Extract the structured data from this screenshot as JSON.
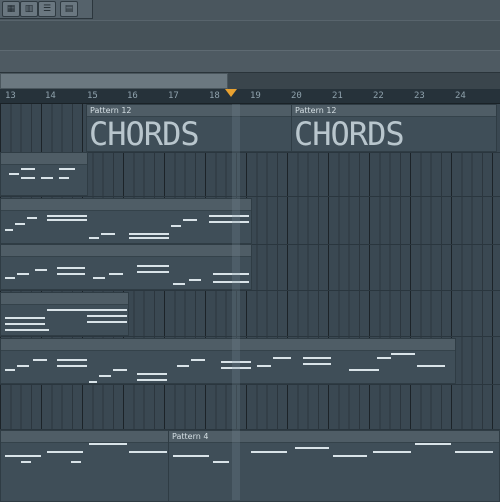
{
  "toolbar": {
    "buttons": [
      {
        "name": "pattern-icon",
        "glyph": "▦"
      },
      {
        "name": "mixer-icon",
        "glyph": "▥"
      },
      {
        "name": "list-icon",
        "glyph": "☰"
      },
      {
        "name": "graph-icon",
        "glyph": "▤"
      }
    ]
  },
  "ruler": {
    "bars": [
      "13",
      "14",
      "15",
      "16",
      "17",
      "18",
      "19",
      "20",
      "21",
      "22",
      "23",
      "24"
    ]
  },
  "clips": {
    "chords_1": {
      "label": "Pattern 12",
      "text": "CHORDS"
    },
    "chords_2": {
      "label": "Pattern 12",
      "text": "CHORDS"
    },
    "pattern_4": {
      "label": "Pattern 4"
    }
  }
}
